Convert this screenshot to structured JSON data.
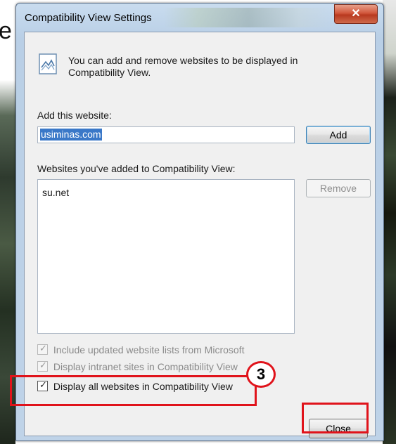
{
  "window": {
    "title": "Compatibility View Settings",
    "close_glyph": "✕",
    "close_icon": "close-icon"
  },
  "info": {
    "icon": "compatibility-view-icon",
    "text": "You can add and remove websites to be displayed in Compatibility View."
  },
  "add_website": {
    "label": "Add this website:",
    "value": "usiminas.com",
    "button_label": "Add"
  },
  "list": {
    "label": "Websites you've added to Compatibility View:",
    "items": [
      "su.net"
    ],
    "remove_label": "Remove"
  },
  "options": [
    {
      "label": "Include updated website lists from Microsoft",
      "checked": true,
      "enabled": false
    },
    {
      "label": "Display intranet sites in Compatibility View",
      "checked": true,
      "enabled": false
    },
    {
      "label": "Display all websites in Compatibility View",
      "checked": true,
      "enabled": true
    }
  ],
  "close_label": "Close",
  "annotation": {
    "step_number": "3",
    "highlight_color": "#e0131b"
  },
  "background": {
    "partial_letter": "e"
  }
}
